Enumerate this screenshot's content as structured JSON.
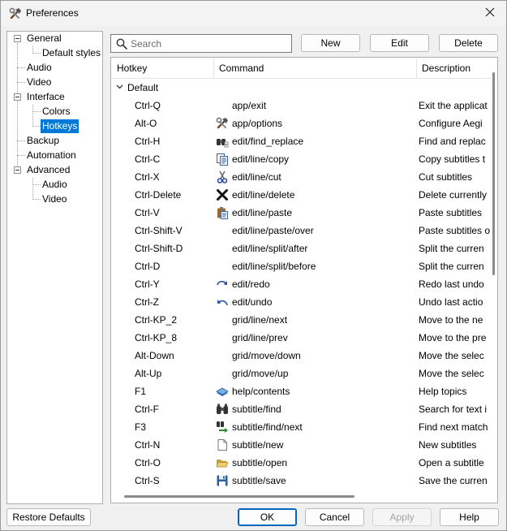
{
  "window": {
    "title": "Preferences"
  },
  "tree": {
    "items": [
      {
        "label": "General"
      },
      {
        "label": "Default styles"
      },
      {
        "label": "Audio"
      },
      {
        "label": "Video"
      },
      {
        "label": "Interface"
      },
      {
        "label": "Colors"
      },
      {
        "label": "Hotkeys"
      },
      {
        "label": "Backup"
      },
      {
        "label": "Automation"
      },
      {
        "label": "Advanced"
      },
      {
        "label": "Audio"
      },
      {
        "label": "Video"
      }
    ]
  },
  "toolbar": {
    "search_placeholder": "Search",
    "search_value": "",
    "new_label": "New",
    "edit_label": "Edit",
    "delete_label": "Delete"
  },
  "list": {
    "columns": [
      "Hotkey",
      "Command",
      "Description"
    ],
    "group": "Default",
    "rows": [
      {
        "hotkey": "Ctrl-Q",
        "icon": "",
        "command": "app/exit",
        "description": "Exit the applicat"
      },
      {
        "hotkey": "Alt-O",
        "icon": "options-icon",
        "command": "app/options",
        "description": "Configure Aegi"
      },
      {
        "hotkey": "Ctrl-H",
        "icon": "find-replace-icon",
        "command": "edit/find_replace",
        "description": "Find and replac"
      },
      {
        "hotkey": "Ctrl-C",
        "icon": "copy-icon",
        "command": "edit/line/copy",
        "description": "Copy subtitles t"
      },
      {
        "hotkey": "Ctrl-X",
        "icon": "cut-icon",
        "command": "edit/line/cut",
        "description": "Cut subtitles"
      },
      {
        "hotkey": "Ctrl-Delete",
        "icon": "delete-icon",
        "command": "edit/line/delete",
        "description": "Delete currently"
      },
      {
        "hotkey": "Ctrl-V",
        "icon": "paste-icon",
        "command": "edit/line/paste",
        "description": "Paste subtitles"
      },
      {
        "hotkey": "Ctrl-Shift-V",
        "icon": "",
        "command": "edit/line/paste/over",
        "description": "Paste subtitles o"
      },
      {
        "hotkey": "Ctrl-Shift-D",
        "icon": "",
        "command": "edit/line/split/after",
        "description": "Split the curren"
      },
      {
        "hotkey": "Ctrl-D",
        "icon": "",
        "command": "edit/line/split/before",
        "description": "Split the curren"
      },
      {
        "hotkey": "Ctrl-Y",
        "icon": "redo-icon",
        "command": "edit/redo",
        "description": "Redo last undo"
      },
      {
        "hotkey": "Ctrl-Z",
        "icon": "undo-icon",
        "command": "edit/undo",
        "description": "Undo last actio"
      },
      {
        "hotkey": "Ctrl-KP_2",
        "icon": "",
        "command": "grid/line/next",
        "description": "Move to the ne"
      },
      {
        "hotkey": "Ctrl-KP_8",
        "icon": "",
        "command": "grid/line/prev",
        "description": "Move to the pre"
      },
      {
        "hotkey": "Alt-Down",
        "icon": "",
        "command": "grid/move/down",
        "description": "Move the selec"
      },
      {
        "hotkey": "Alt-Up",
        "icon": "",
        "command": "grid/move/up",
        "description": "Move the selec"
      },
      {
        "hotkey": "F1",
        "icon": "help-book-icon",
        "command": "help/contents",
        "description": "Help topics"
      },
      {
        "hotkey": "Ctrl-F",
        "icon": "binoculars-icon",
        "command": "subtitle/find",
        "description": "Search for text i"
      },
      {
        "hotkey": "F3",
        "icon": "find-next-icon",
        "command": "subtitle/find/next",
        "description": "Find next match"
      },
      {
        "hotkey": "Ctrl-N",
        "icon": "new-file-icon",
        "command": "subtitle/new",
        "description": "New subtitles"
      },
      {
        "hotkey": "Ctrl-O",
        "icon": "open-folder-icon",
        "command": "subtitle/open",
        "description": "Open a subtitle"
      },
      {
        "hotkey": "Ctrl-S",
        "icon": "save-icon",
        "command": "subtitle/save",
        "description": "Save the curren"
      }
    ]
  },
  "footer": {
    "restore_label": "Restore Defaults",
    "ok_label": "OK",
    "cancel_label": "Cancel",
    "apply_label": "Apply",
    "help_label": "Help"
  }
}
